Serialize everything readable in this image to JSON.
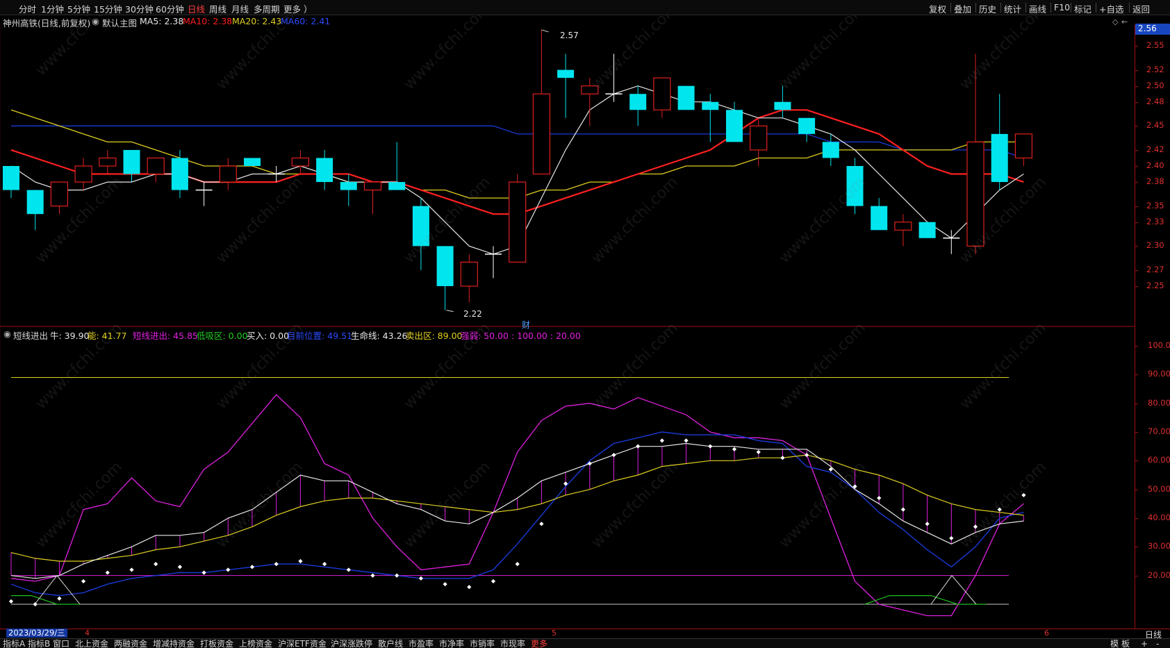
{
  "top_tabs": [
    "分时",
    "1分钟",
    "5分钟",
    "15分钟",
    "30分钟",
    "60分钟",
    "日线",
    "周线",
    "月线",
    "多周期",
    "更多 ）"
  ],
  "active_tab": "日线",
  "top_tools": [
    "复权",
    "叠加",
    "历史",
    "统计",
    "画线",
    "F10",
    "标记",
    "+自选",
    "返回"
  ],
  "main_header": {
    "title": "神州高铁(日线,前复权)",
    "indicator": "默认主图",
    "ma5": "MA5: 2.38",
    "ma10": "MA10: 2.38",
    "ma20": "MA20: 2.43",
    "ma60": "MA60: 2.41"
  },
  "last_price": "2.56",
  "main_axis": [
    "2.55",
    "2.52",
    "2.50",
    "2.48",
    "2.45",
    "2.42",
    "2.40",
    "2.38",
    "2.35",
    "2.33",
    "2.30",
    "2.27",
    "2.25"
  ],
  "sub_axis": [
    "100.0",
    "90.00",
    "80.00",
    "70.00",
    "60.00",
    "50.00",
    "40.00",
    "30.00",
    "20.00"
  ],
  "annotations": {
    "high": "2.57",
    "low": "2.22",
    "cai": "财"
  },
  "sub_header": {
    "name": "短线进出",
    "niu": "牛: 39.90",
    "neng": "能: 41.77",
    "dxjc": "短线进出: 45.85",
    "dxq": "低吸区: 0.00",
    "mairu": "买入: 0.00",
    "mqwz": "目前位置: 49.51",
    "smx": "生命线: 43.26",
    "mcq": "卖出区: 89.00",
    "qr": "强弱: 50.00 : 100.00 : 20.00"
  },
  "date_tag": "2023/03/29/三",
  "x_marks": [
    "4",
    "5",
    "6"
  ],
  "period": "日线",
  "bottom_tabs": [
    "指标A",
    "指标B",
    "窗口",
    "北上资金",
    "两融资金",
    "增减持资金",
    "打板资金",
    "上榜资金",
    "沪深ETF资金",
    "沪深涨跌停",
    "散户线",
    "市盈率",
    "市净率",
    "市销率",
    "市现率",
    "更多"
  ],
  "bottom_right": [
    "模",
    "板",
    "+",
    "-"
  ],
  "colors": {
    "up": "#e02020",
    "down": "#00e5ee",
    "ma5": "#e8e8e8",
    "ma10": "#ff2020",
    "ma20": "#e0d020",
    "ma60": "#1a3ad8",
    "magenta": "#e020e0"
  },
  "chart_data": [
    {
      "type": "candlestick",
      "title": "神州高铁(日线,前复权)",
      "ylim": [
        2.22,
        2.57
      ],
      "candles": [
        {
          "o": 2.4,
          "h": 2.4,
          "l": 2.36,
          "c": 2.37
        },
        {
          "o": 2.37,
          "h": 2.37,
          "l": 2.32,
          "c": 2.34
        },
        {
          "o": 2.35,
          "h": 2.38,
          "l": 2.34,
          "c": 2.38
        },
        {
          "o": 2.38,
          "h": 2.41,
          "l": 2.37,
          "c": 2.4
        },
        {
          "o": 2.4,
          "h": 2.42,
          "l": 2.39,
          "c": 2.41
        },
        {
          "o": 2.42,
          "h": 2.42,
          "l": 2.38,
          "c": 2.39
        },
        {
          "o": 2.39,
          "h": 2.41,
          "l": 2.38,
          "c": 2.41
        },
        {
          "o": 2.41,
          "h": 2.42,
          "l": 2.36,
          "c": 2.37
        },
        {
          "o": 2.37,
          "h": 2.38,
          "l": 2.35,
          "c": 2.37
        },
        {
          "o": 2.38,
          "h": 2.41,
          "l": 2.37,
          "c": 2.4
        },
        {
          "o": 2.41,
          "h": 2.41,
          "l": 2.4,
          "c": 2.4
        },
        {
          "o": 2.39,
          "h": 2.4,
          "l": 2.38,
          "c": 2.39
        },
        {
          "o": 2.4,
          "h": 2.42,
          "l": 2.39,
          "c": 2.41
        },
        {
          "o": 2.41,
          "h": 2.42,
          "l": 2.37,
          "c": 2.38
        },
        {
          "o": 2.38,
          "h": 2.39,
          "l": 2.35,
          "c": 2.37
        },
        {
          "o": 2.37,
          "h": 2.38,
          "l": 2.34,
          "c": 2.38
        },
        {
          "o": 2.38,
          "h": 2.43,
          "l": 2.37,
          "c": 2.37
        },
        {
          "o": 2.35,
          "h": 2.36,
          "l": 2.27,
          "c": 2.3
        },
        {
          "o": 2.3,
          "h": 2.3,
          "l": 2.22,
          "c": 2.25
        },
        {
          "o": 2.25,
          "h": 2.29,
          "l": 2.23,
          "c": 2.28
        },
        {
          "o": 2.29,
          "h": 2.3,
          "l": 2.26,
          "c": 2.29
        },
        {
          "o": 2.28,
          "h": 2.39,
          "l": 2.28,
          "c": 2.38
        },
        {
          "o": 2.39,
          "h": 2.57,
          "l": 2.39,
          "c": 2.49
        },
        {
          "o": 2.52,
          "h": 2.54,
          "l": 2.46,
          "c": 2.51
        },
        {
          "o": 2.49,
          "h": 2.51,
          "l": 2.45,
          "c": 2.5
        },
        {
          "o": 2.49,
          "h": 2.54,
          "l": 2.48,
          "c": 2.49
        },
        {
          "o": 2.49,
          "h": 2.5,
          "l": 2.45,
          "c": 2.47
        },
        {
          "o": 2.47,
          "h": 2.51,
          "l": 2.46,
          "c": 2.51
        },
        {
          "o": 2.5,
          "h": 2.5,
          "l": 2.47,
          "c": 2.47
        },
        {
          "o": 2.48,
          "h": 2.49,
          "l": 2.43,
          "c": 2.47
        },
        {
          "o": 2.47,
          "h": 2.48,
          "l": 2.43,
          "c": 2.43
        },
        {
          "o": 2.42,
          "h": 2.46,
          "l": 2.4,
          "c": 2.45
        },
        {
          "o": 2.48,
          "h": 2.5,
          "l": 2.46,
          "c": 2.47
        },
        {
          "o": 2.46,
          "h": 2.46,
          "l": 2.43,
          "c": 2.44
        },
        {
          "o": 2.43,
          "h": 2.44,
          "l": 2.4,
          "c": 2.41
        },
        {
          "o": 2.4,
          "h": 2.41,
          "l": 2.34,
          "c": 2.35
        },
        {
          "o": 2.35,
          "h": 2.36,
          "l": 2.32,
          "c": 2.32
        },
        {
          "o": 2.32,
          "h": 2.34,
          "l": 2.3,
          "c": 2.33
        },
        {
          "o": 2.33,
          "h": 2.33,
          "l": 2.31,
          "c": 2.31
        },
        {
          "o": 2.31,
          "h": 2.32,
          "l": 2.29,
          "c": 2.31
        },
        {
          "o": 2.3,
          "h": 2.54,
          "l": 2.29,
          "c": 2.43
        },
        {
          "o": 2.44,
          "h": 2.49,
          "l": 2.37,
          "c": 2.38
        },
        {
          "o": 2.41,
          "h": 2.44,
          "l": 2.4,
          "c": 2.44
        }
      ],
      "series": [
        {
          "name": "MA5",
          "values": [
            2.4,
            2.38,
            2.37,
            2.37,
            2.38,
            2.38,
            2.39,
            2.39,
            2.38,
            2.38,
            2.39,
            2.39,
            2.4,
            2.39,
            2.38,
            2.38,
            2.38,
            2.36,
            2.33,
            2.3,
            2.29,
            2.3,
            2.36,
            2.42,
            2.47,
            2.49,
            2.5,
            2.49,
            2.48,
            2.48,
            2.47,
            2.46,
            2.46,
            2.45,
            2.44,
            2.42,
            2.39,
            2.36,
            2.33,
            2.31,
            2.34,
            2.37,
            2.39
          ]
        },
        {
          "name": "MA10",
          "values": [
            2.42,
            2.41,
            2.4,
            2.39,
            2.39,
            2.39,
            2.39,
            2.39,
            2.38,
            2.38,
            2.38,
            2.38,
            2.39,
            2.39,
            2.39,
            2.38,
            2.38,
            2.37,
            2.36,
            2.35,
            2.34,
            2.34,
            2.35,
            2.36,
            2.37,
            2.38,
            2.39,
            2.4,
            2.41,
            2.42,
            2.44,
            2.46,
            2.47,
            2.47,
            2.46,
            2.45,
            2.44,
            2.42,
            2.4,
            2.39,
            2.39,
            2.39,
            2.38
          ]
        },
        {
          "name": "MA20",
          "values": [
            2.47,
            2.46,
            2.45,
            2.44,
            2.43,
            2.43,
            2.42,
            2.41,
            2.4,
            2.4,
            2.4,
            2.39,
            2.39,
            2.39,
            2.38,
            2.38,
            2.38,
            2.37,
            2.37,
            2.36,
            2.36,
            2.36,
            2.37,
            2.37,
            2.38,
            2.38,
            2.39,
            2.39,
            2.4,
            2.4,
            2.4,
            2.41,
            2.41,
            2.41,
            2.42,
            2.42,
            2.42,
            2.42,
            2.42,
            2.42,
            2.43,
            2.43,
            2.43
          ]
        },
        {
          "name": "MA60",
          "values": [
            2.45,
            2.45,
            2.45,
            2.45,
            2.45,
            2.45,
            2.45,
            2.45,
            2.45,
            2.45,
            2.45,
            2.45,
            2.45,
            2.45,
            2.45,
            2.45,
            2.45,
            2.45,
            2.45,
            2.45,
            2.45,
            2.44,
            2.44,
            2.44,
            2.44,
            2.44,
            2.44,
            2.44,
            2.44,
            2.44,
            2.44,
            2.44,
            2.44,
            2.44,
            2.43,
            2.43,
            2.43,
            2.42,
            2.42,
            2.42,
            2.42,
            2.42,
            2.41
          ]
        }
      ]
    },
    {
      "type": "line",
      "title": "短线进出",
      "ylim": [
        0,
        100
      ],
      "series": [
        {
          "name": "短线进出",
          "values": [
            19,
            18,
            20,
            43,
            45,
            54,
            46,
            44,
            57,
            63,
            73,
            83,
            75,
            59,
            55,
            40,
            30,
            22,
            23,
            24,
            42,
            63,
            74,
            79,
            80,
            78,
            82,
            79,
            76,
            70,
            68,
            68,
            67,
            62,
            40,
            18,
            10,
            8,
            6,
            6,
            20,
            38,
            45
          ]
        },
        {
          "name": "目前位置",
          "values": [
            11,
            10,
            12,
            18,
            21,
            22,
            24,
            23,
            21,
            22,
            23,
            24,
            25,
            24,
            22,
            20,
            20,
            19,
            17,
            16,
            18,
            24,
            38,
            52,
            59,
            62,
            65,
            67,
            67,
            65,
            64,
            63,
            61,
            62,
            57,
            51,
            47,
            43,
            38,
            33,
            37,
            43,
            48
          ]
        },
        {
          "name": "生命线",
          "values": [
            28,
            26,
            25,
            25,
            26,
            27,
            29,
            30,
            32,
            34,
            37,
            41,
            44,
            46,
            47,
            47,
            46,
            45,
            44,
            43,
            42,
            43,
            45,
            48,
            50,
            53,
            55,
            58,
            59,
            60,
            60,
            61,
            61,
            62,
            60,
            57,
            55,
            52,
            48,
            45,
            43,
            42,
            41
          ]
        },
        {
          "name": "牛",
          "values": [
            20,
            19,
            20,
            24,
            27,
            30,
            34,
            34,
            35,
            40,
            43,
            49,
            55,
            53,
            53,
            49,
            45,
            43,
            39,
            38,
            42,
            47,
            53,
            56,
            59,
            62,
            65,
            65,
            66,
            65,
            65,
            64,
            64,
            64,
            58,
            50,
            45,
            39,
            35,
            31,
            35,
            38,
            39
          ]
        },
        {
          "name": "能",
          "values": [
            17,
            14,
            13,
            14,
            17,
            19,
            20,
            21,
            21,
            22,
            23,
            24,
            24,
            23,
            22,
            21,
            20,
            19,
            19,
            19,
            22,
            31,
            41,
            51,
            60,
            66,
            68,
            70,
            69,
            69,
            69,
            67,
            66,
            58,
            56,
            50,
            42,
            36,
            29,
            23,
            30,
            40,
            42
          ]
        },
        {
          "name": "卖出区",
          "values": [
            89
          ]
        },
        {
          "name": "强弱",
          "values": [
            20
          ]
        }
      ]
    }
  ]
}
